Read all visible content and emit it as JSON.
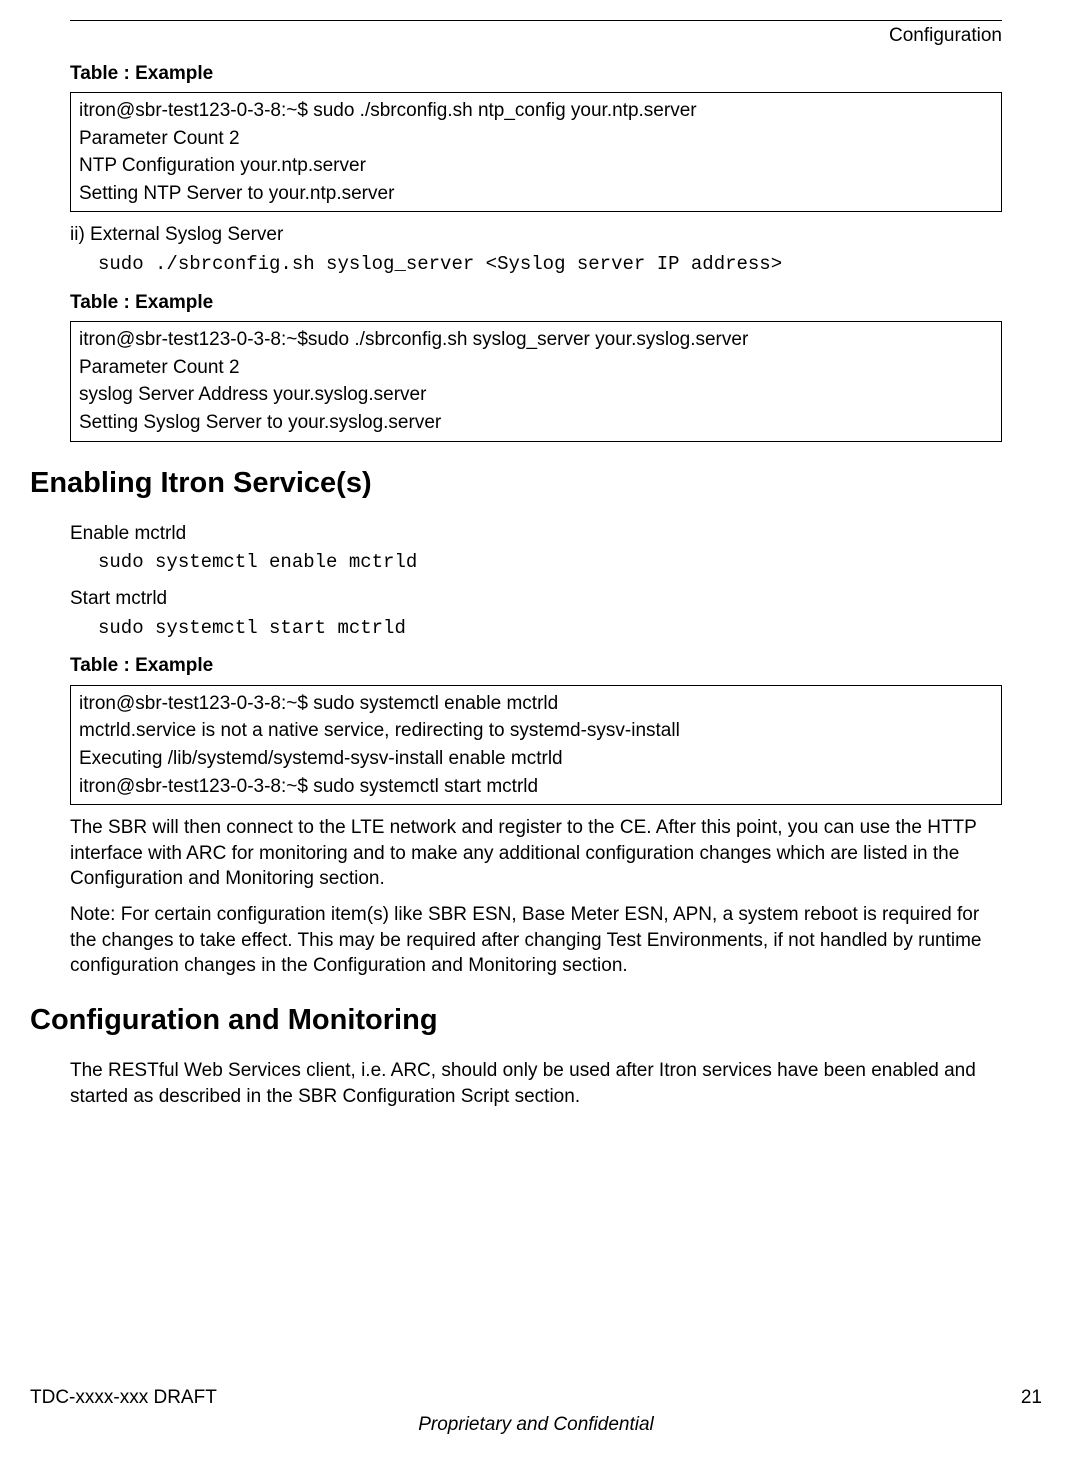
{
  "header": {
    "section": "Configuration"
  },
  "table1": {
    "label": "Table : Example",
    "line1": "itron@sbr-test123-0-3-8:~$ sudo ./sbrconfig.sh ntp_config your.ntp.server",
    "line2": "Parameter Count 2",
    "line3": "NTP Configuration your.ntp.server",
    "line4": "Setting NTP Server to your.ntp.server"
  },
  "syslog": {
    "label": "ii) External Syslog Server",
    "cmd": "sudo ./sbrconfig.sh syslog_server <Syslog server IP address>"
  },
  "table2": {
    "label": "Table : Example",
    "line1": "itron@sbr-test123-0-3-8:~$sudo ./sbrconfig.sh syslog_server your.syslog.server",
    "line2": "Parameter Count 2",
    "line3": "syslog Server Address your.syslog.server",
    "line4": "Setting Syslog Server to your.syslog.server"
  },
  "section1": {
    "heading": "Enabling Itron Service(s)",
    "enable_label": "Enable mctrld",
    "enable_cmd": "sudo systemctl enable mctrld",
    "start_label": "Start mctrld",
    "start_cmd": "sudo systemctl start mctrld"
  },
  "table3": {
    "label": "Table : Example",
    "line1": "itron@sbr-test123-0-3-8:~$ sudo systemctl enable mctrld",
    "line2": "mctrld.service is not a native service, redirecting to systemd-sysv-install",
    "line3": "Executing /lib/systemd/systemd-sysv-install enable mctrld",
    "line4": "itron@sbr-test123-0-3-8:~$ sudo systemctl start mctrld"
  },
  "para1": "The SBR will then connect to the LTE network and register to the CE. After this point, you can use the HTTP interface with ARC for monitoring and to make any additional configuration changes which are listed in the Configuration and Monitoring section.",
  "para2": "Note: For certain configuration item(s) like SBR ESN, Base Meter ESN, APN, a system reboot is required for the changes to take effect. This may be required after changing Test Environments, if not handled by runtime configuration changes in the Configuration and Monitoring section.",
  "section2": {
    "heading": "Configuration and Monitoring",
    "para": "The RESTful Web Services client, i.e. ARC, should only be used after Itron services have been enabled and started as described in the SBR Configuration Script section."
  },
  "footer": {
    "left": "TDC-xxxx-xxx DRAFT",
    "right": "21",
    "center": "Proprietary and Confidential"
  }
}
